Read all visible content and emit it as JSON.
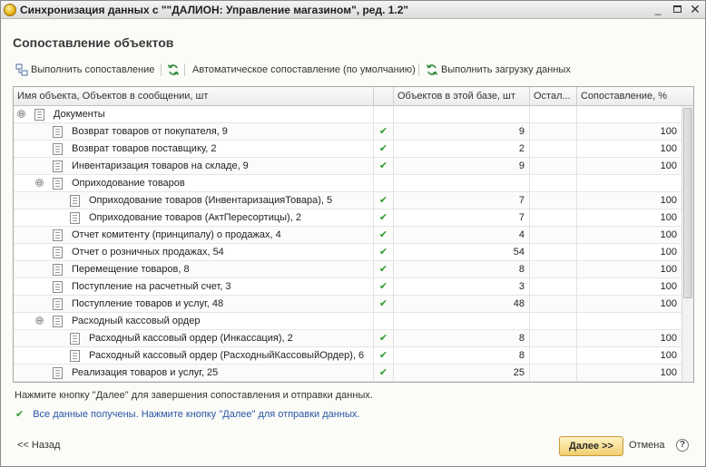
{
  "window": {
    "title": "Синхронизация данных с \"\"ДАЛИОН: Управление магазином\", ред. 1.2\"",
    "min_glyph": "_",
    "close_glyph": "✕"
  },
  "form_title": "Сопоставление объектов",
  "toolbar": {
    "run_mapping": "Выполнить сопоставление",
    "auto_mapping": "Автоматическое сопоставление (по умолчанию)",
    "load_data": "Выполнить загрузку данных"
  },
  "table": {
    "columns": {
      "name": "Имя объекта, Объектов в сообщении, шт",
      "in_base": "Объектов в этой базе, шт",
      "rest": "Остал...",
      "mapping": "Сопоставление, %"
    },
    "rows": [
      {
        "name": "Документы",
        "level": 0,
        "expander": "⊖",
        "mark": "",
        "in_base": "",
        "rest": "",
        "pct": ""
      },
      {
        "name": "Возврат товаров от покупателя, 9",
        "level": 1,
        "expander": "",
        "mark": "✔",
        "in_base": "9",
        "rest": "",
        "pct": "100"
      },
      {
        "name": "Возврат товаров поставщику, 2",
        "level": 1,
        "expander": "",
        "mark": "✔",
        "in_base": "2",
        "rest": "",
        "pct": "100"
      },
      {
        "name": "Инвентаризация товаров на складе, 9",
        "level": 1,
        "expander": "",
        "mark": "✔",
        "in_base": "9",
        "rest": "",
        "pct": "100"
      },
      {
        "name": "Оприходование товаров",
        "level": 1,
        "expander": "⊖",
        "mark": "",
        "in_base": "",
        "rest": "",
        "pct": ""
      },
      {
        "name": "Оприходование товаров (ИнвентаризацияТовара), 5",
        "level": 2,
        "expander": "",
        "mark": "✔",
        "in_base": "7",
        "rest": "",
        "pct": "100"
      },
      {
        "name": "Оприходование товаров (АктПересортицы), 2",
        "level": 2,
        "expander": "",
        "mark": "✔",
        "in_base": "7",
        "rest": "",
        "pct": "100"
      },
      {
        "name": "Отчет комитенту (принципалу) о продажах, 4",
        "level": 1,
        "expander": "",
        "mark": "✔",
        "in_base": "4",
        "rest": "",
        "pct": "100"
      },
      {
        "name": "Отчет о розничных продажах, 54",
        "level": 1,
        "expander": "",
        "mark": "✔",
        "in_base": "54",
        "rest": "",
        "pct": "100"
      },
      {
        "name": "Перемещение товаров, 8",
        "level": 1,
        "expander": "",
        "mark": "✔",
        "in_base": "8",
        "rest": "",
        "pct": "100"
      },
      {
        "name": "Поступление на расчетный счет, 3",
        "level": 1,
        "expander": "",
        "mark": "✔",
        "in_base": "3",
        "rest": "",
        "pct": "100"
      },
      {
        "name": "Поступление товаров и услуг, 48",
        "level": 1,
        "expander": "",
        "mark": "✔",
        "in_base": "48",
        "rest": "",
        "pct": "100"
      },
      {
        "name": "Расходный кассовый ордер",
        "level": 1,
        "expander": "⊖",
        "mark": "",
        "in_base": "",
        "rest": "",
        "pct": ""
      },
      {
        "name": "Расходный кассовый ордер (Инкассация), 2",
        "level": 2,
        "expander": "",
        "mark": "✔",
        "in_base": "8",
        "rest": "",
        "pct": "100"
      },
      {
        "name": "Расходный кассовый ордер (РасходныйКассовыйОрдер), 6",
        "level": 2,
        "expander": "",
        "mark": "✔",
        "in_base": "8",
        "rest": "",
        "pct": "100"
      },
      {
        "name": "Реализация товаров и услуг, 25",
        "level": 1,
        "expander": "",
        "mark": "✔",
        "in_base": "25",
        "rest": "",
        "pct": "100"
      }
    ]
  },
  "hint": "Нажмите кнопку \"Далее\" для завершения сопоставления и отправки данных.",
  "status": {
    "icon": "✔",
    "text": "Все данные получены. Нажмите кнопку \"Далее\" для отправки данных."
  },
  "nav": {
    "back": "<< Назад",
    "next": "Далее >>",
    "cancel": "Отмена",
    "help": "?"
  },
  "colors": {
    "accent_button": "#f0cf6e",
    "status_text": "#2b56a6",
    "check": "#2e9b2e"
  }
}
